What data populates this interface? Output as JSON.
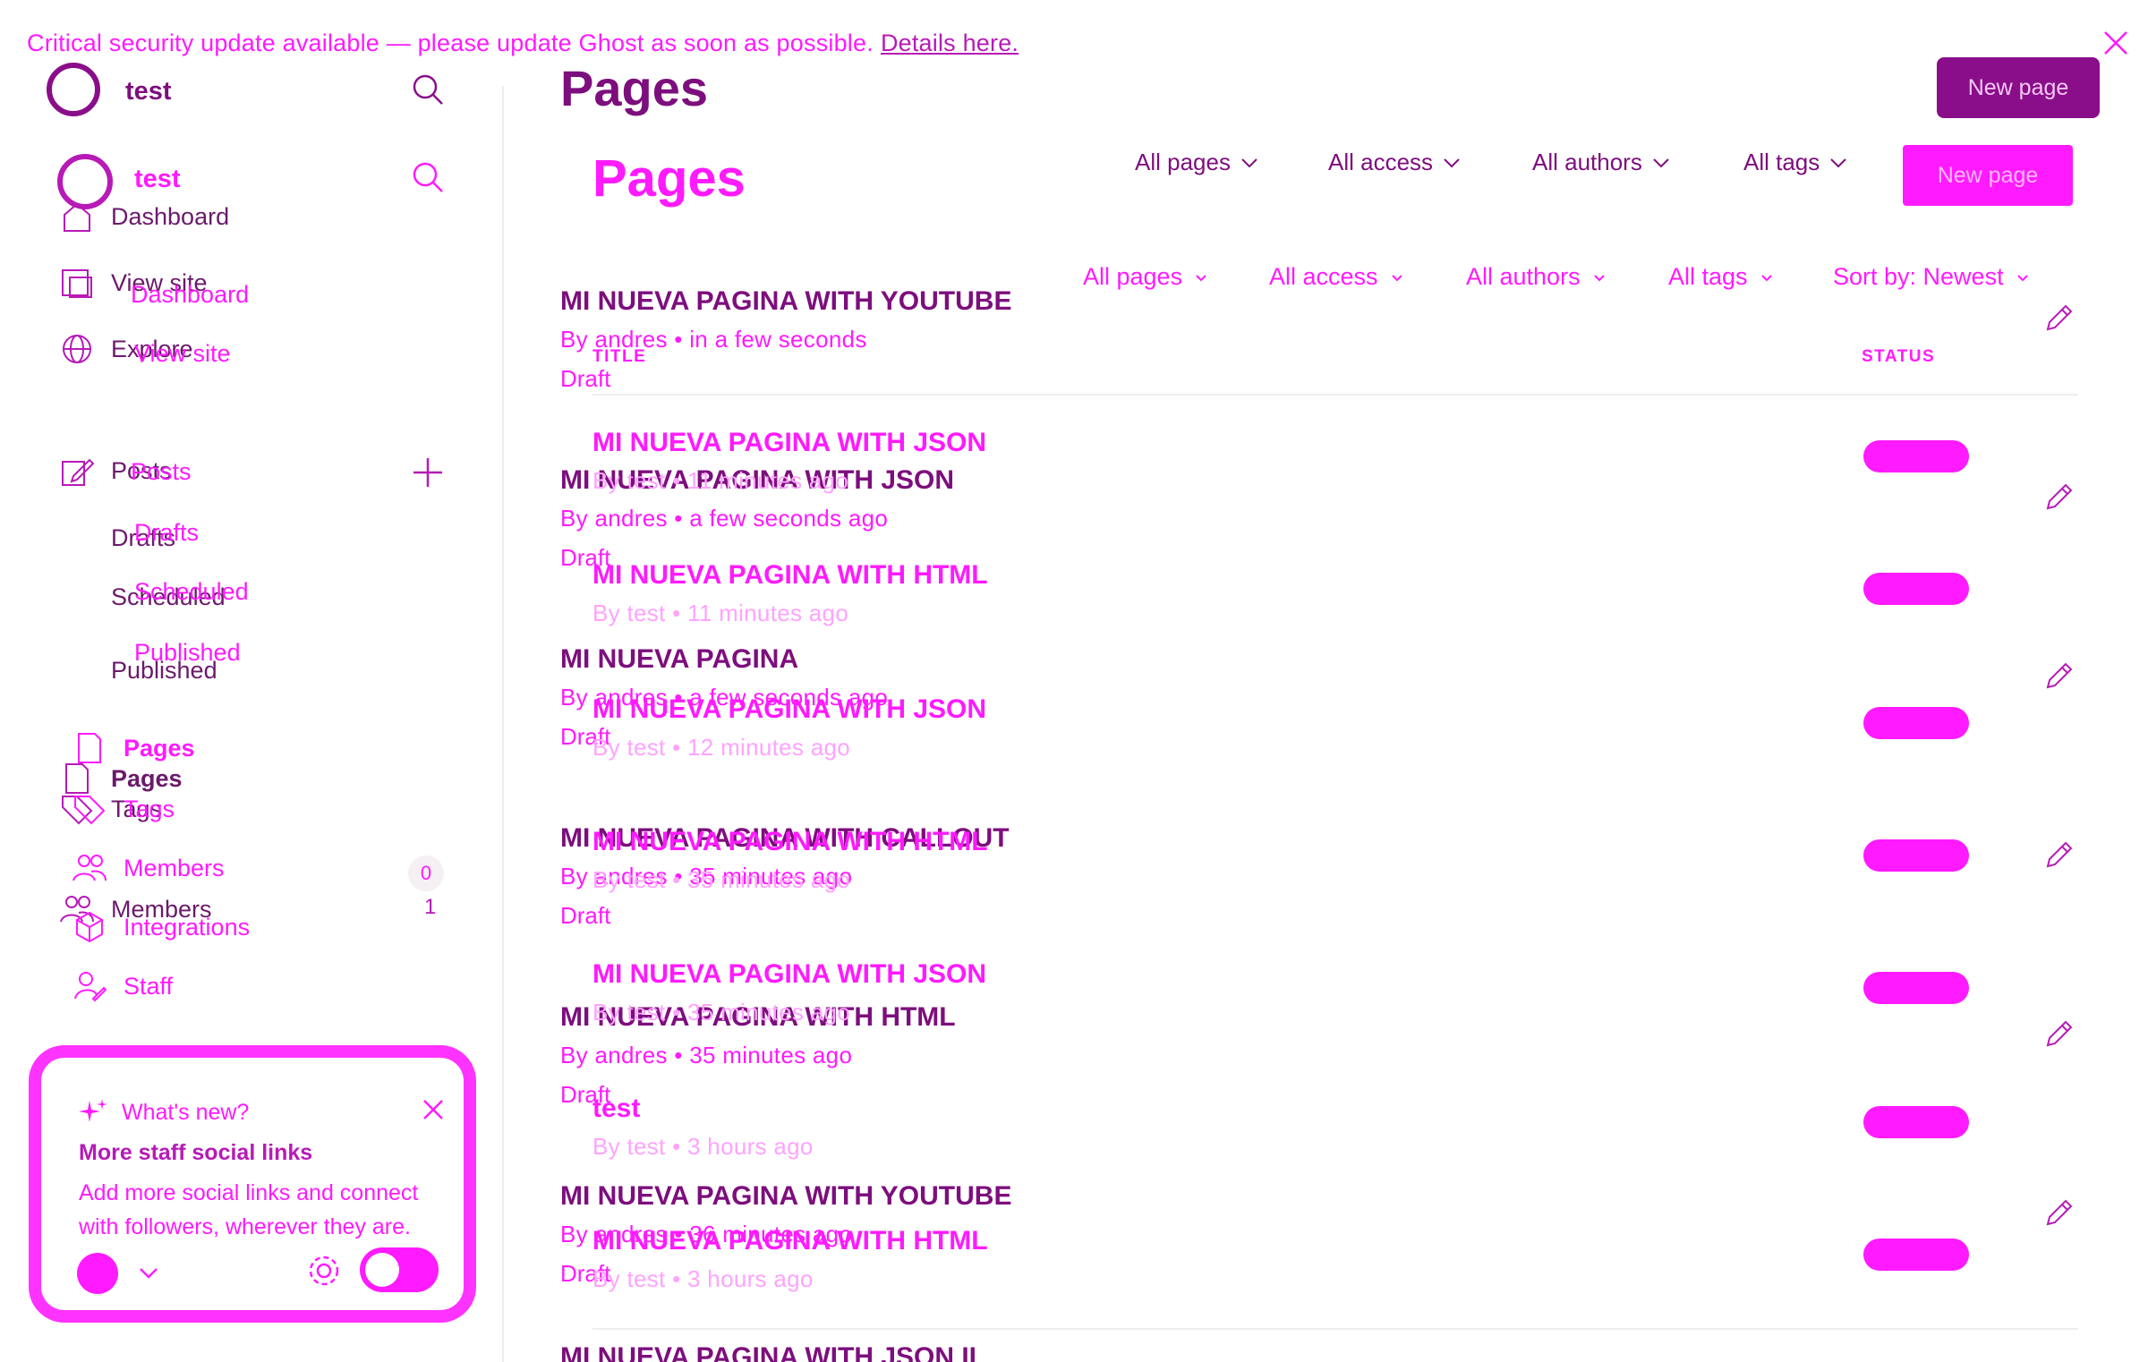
{
  "banner": {
    "text": "Critical security update available — please update Ghost as soon as possible.",
    "link": "Details here."
  },
  "sidebar": {
    "site_name_a": "test",
    "site_name_b": "test",
    "nav_a": {
      "dashboard": "Dashboard",
      "view_site": "View site",
      "explore": "Explore",
      "posts": "Posts",
      "drafts": "Drafts",
      "scheduled": "Scheduled",
      "published": "Published",
      "pages": "Pages",
      "tags": "Tags",
      "members": "Members",
      "members_count": "1"
    },
    "nav_b": {
      "dashboard": "Dashboard",
      "view_site": "View site",
      "posts": "Posts",
      "drafts": "Drafts",
      "scheduled": "Scheduled",
      "published": "Published",
      "pages": "Pages",
      "tags": "Tags",
      "members": "Members",
      "members_count": "0",
      "integrations": "Integrations",
      "staff": "Staff"
    }
  },
  "whats_new": {
    "label": "What's new?",
    "title": "More staff social links",
    "body": "Add more social links and connect with followers, wherever they are."
  },
  "header": {
    "title_a": "Pages",
    "title_b": "Pages",
    "new_page_a": "New page",
    "new_page_b": "New page"
  },
  "filters_a": [
    "All pages",
    "All access",
    "All authors",
    "All tags"
  ],
  "filters_b": [
    "All pages",
    "All access",
    "All authors",
    "All tags",
    "Sort by: Newest"
  ],
  "columns": {
    "title": "TITLE",
    "status": "STATUS"
  },
  "list_a": [
    {
      "title": "MI NUEVA PAGINA WITH YOUTUBE",
      "meta": "By andres • in a few seconds",
      "status": "Draft"
    },
    {
      "title": "MI NUEVA PAGINA WITH JSON",
      "meta": "By andres • a few seconds ago",
      "status": "Draft"
    },
    {
      "title": "MI NUEVA PAGINA",
      "meta": "By andres • a few seconds ago",
      "status": "Draft"
    },
    {
      "title": "MI NUEVA PAGINA WITH CALLOUT",
      "meta": "By andres • 35 minutes ago",
      "status": "Draft"
    },
    {
      "title": "MI NUEVA PAGINA WITH HTML",
      "meta": "By andres • 35 minutes ago",
      "status": "Draft"
    },
    {
      "title": "MI NUEVA PAGINA WITH YOUTUBE",
      "meta": "By andres • 36 minutes ago",
      "status": "Draft"
    },
    {
      "title": "MI NUEVA PAGINA WITH JSON II"
    }
  ],
  "list_b": [
    {
      "title": "MI NUEVA PAGINA WITH JSON",
      "meta": "By test • 11 minutes ago"
    },
    {
      "title": "MI NUEVA PAGINA WITH HTML",
      "meta": "By test • 11 minutes ago"
    },
    {
      "title": "MI NUEVA PAGINA WITH JSON",
      "meta": "By test • 12 minutes ago"
    },
    {
      "title": "MI NUEVA PAGINA WITH HTML",
      "meta": "By test • 35 minutes ago"
    },
    {
      "title": "MI NUEVA PAGINA WITH JSON",
      "meta": "By test • 35 minutes ago"
    },
    {
      "title": "test",
      "meta": "By test • 3 hours ago"
    },
    {
      "title": "MI NUEVA PAGINA WITH HTML",
      "meta": "By test • 3 hours ago"
    }
  ],
  "colors": {
    "accent": "#ff1aff",
    "dark_accent": "#7d0e7d",
    "button": "#8a0e8a"
  },
  "icons": [
    "close-icon",
    "search-icon",
    "home-icon",
    "external-link-icon",
    "globe-icon",
    "edit-post-icon",
    "plus-icon",
    "page-icon",
    "tag-icon",
    "members-icon",
    "integrations-icon",
    "staff-icon",
    "sparkle-icon",
    "gear-icon",
    "chevron-down-icon",
    "pencil-icon"
  ]
}
